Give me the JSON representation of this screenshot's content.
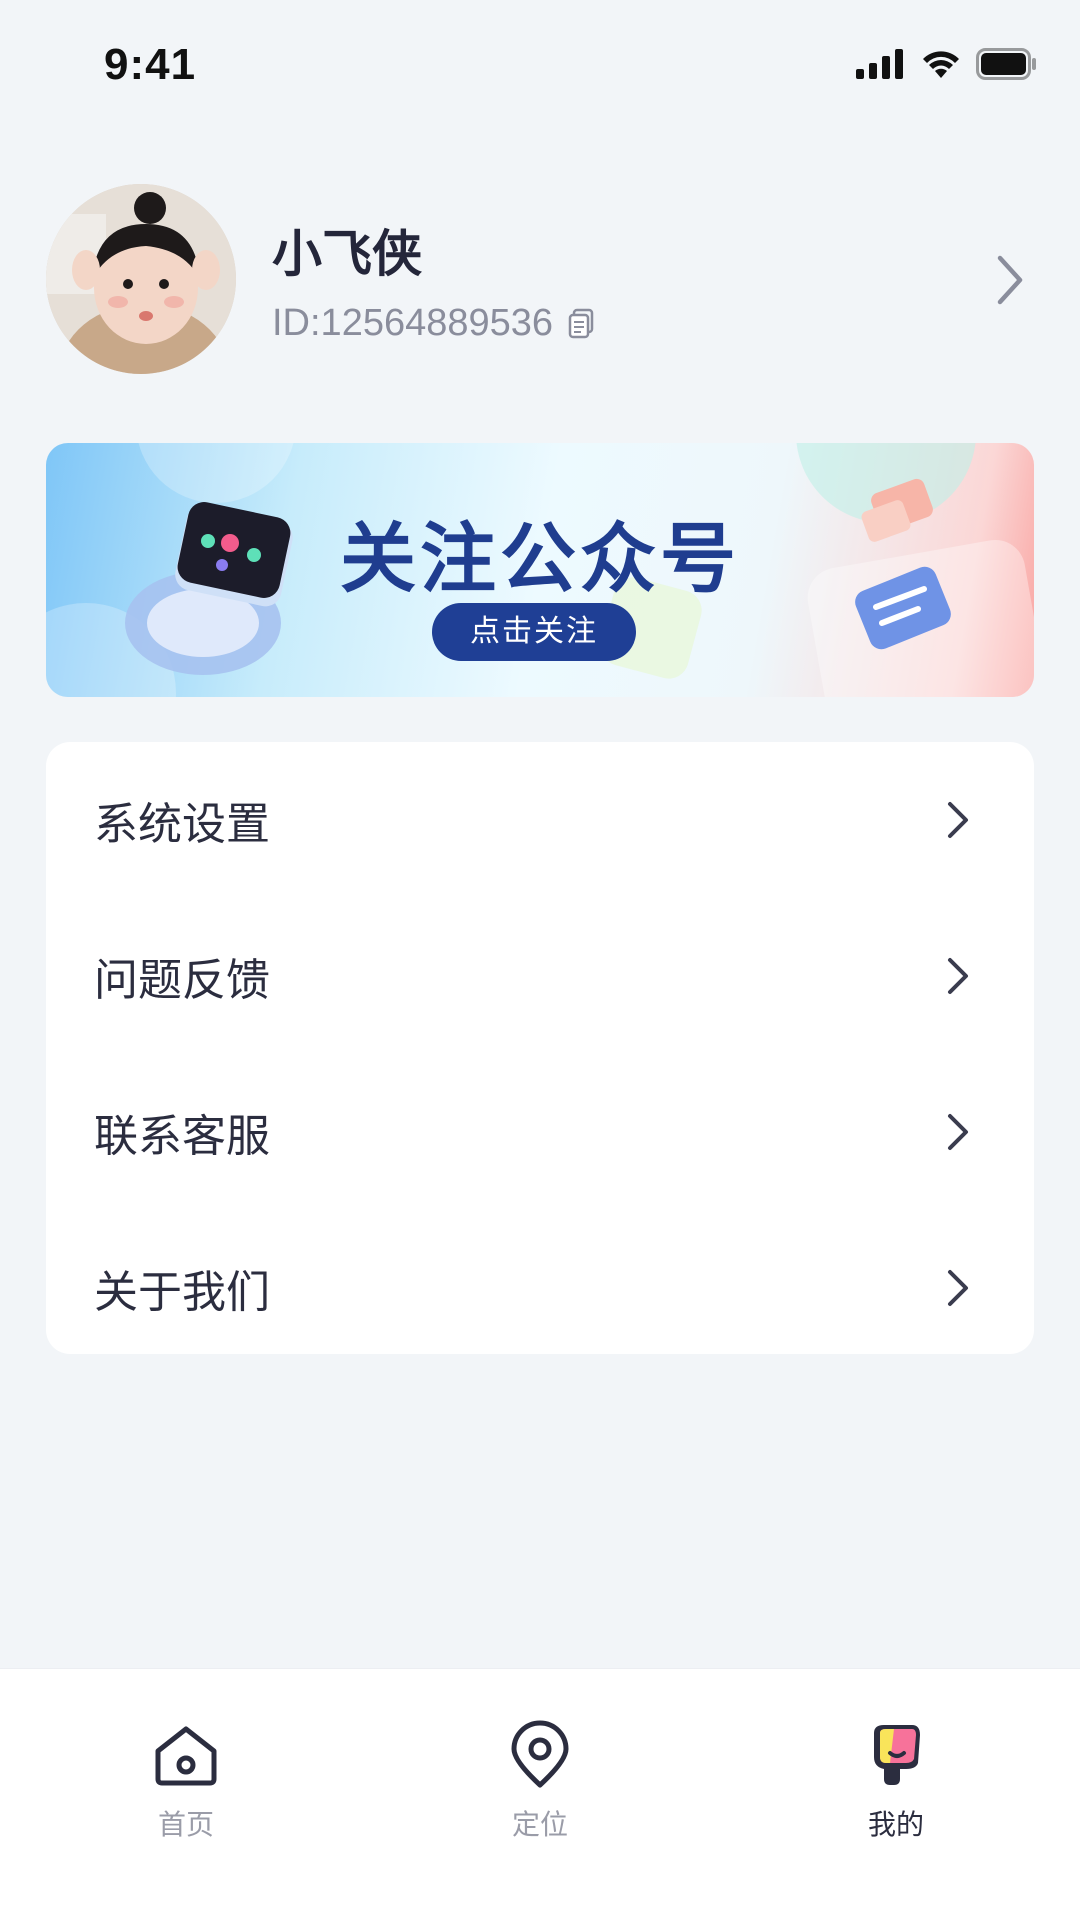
{
  "status_bar": {
    "time": "9:41"
  },
  "profile": {
    "name": "小飞侠",
    "id_text": "ID:12564889536"
  },
  "banner": {
    "title": "关注公众号",
    "button_label": "点击关注"
  },
  "menu": {
    "items": [
      {
        "label": "系统设置"
      },
      {
        "label": "问题反馈"
      },
      {
        "label": "联系客服"
      },
      {
        "label": "关于我们"
      }
    ]
  },
  "bottom_nav": {
    "items": [
      {
        "label": "首页",
        "icon": "home-icon",
        "active": false
      },
      {
        "label": "定位",
        "icon": "location-icon",
        "active": false
      },
      {
        "label": "我的",
        "icon": "profile-icon",
        "active": true
      }
    ]
  },
  "colors": {
    "background": "#f2f5f8",
    "banner_accent": "#1f3f95",
    "text_primary": "#2b2d3f",
    "text_secondary": "#9a9ca8"
  }
}
